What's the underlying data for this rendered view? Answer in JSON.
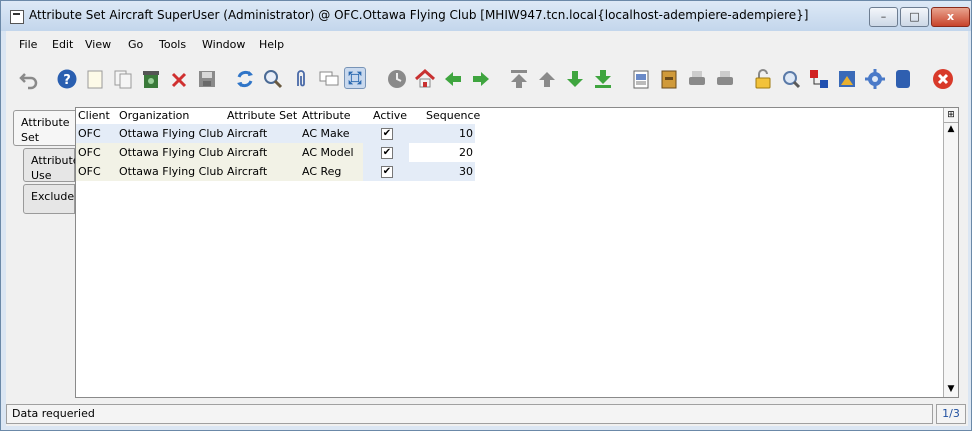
{
  "window": {
    "title": "Attribute Set  Aircraft  SuperUser (Administrator) @ OFC.Ottawa Flying Club [MHIW947.tcn.local{localhost-adempiere-adempiere}]",
    "min": "–",
    "max": "□",
    "close": "x"
  },
  "menu": [
    "File",
    "Edit",
    "View",
    "Go",
    "Tools",
    "Window",
    "Help"
  ],
  "menu_mnemonics": [
    "F",
    "E",
    "V",
    "G",
    "T",
    "",
    "H"
  ],
  "tabs": [
    {
      "label": "Attribute Set",
      "line1": "Attribute",
      "line2": "Set"
    },
    {
      "label": "Attribute Use",
      "line1": "Attribute",
      "line2": "Use"
    },
    {
      "label": "Exclude",
      "line1": "Exclude",
      "line2": ""
    }
  ],
  "grid": {
    "columns": [
      "Client",
      "Organization",
      "Attribute Set",
      "Attribute",
      "Active",
      "Sequence"
    ],
    "rows": [
      {
        "client": "OFC",
        "org": "Ottawa Flying Club",
        "set": "Aircraft",
        "attribute": "AC Make",
        "active": "✔",
        "sequence": "10"
      },
      {
        "client": "OFC",
        "org": "Ottawa Flying Club",
        "set": "Aircraft",
        "attribute": "AC Model",
        "active": "✔",
        "sequence": "20"
      },
      {
        "client": "OFC",
        "org": "Ottawa Flying Club",
        "set": "Aircraft",
        "attribute": "AC Reg",
        "active": "✔",
        "sequence": "30"
      }
    ]
  },
  "status": {
    "message": "Data requeried",
    "pager": "1/3"
  },
  "toolbar_icons": [
    "undo-icon",
    "help-icon",
    "new-record-icon",
    "copy-record-icon",
    "delete-icon",
    "delete-selection-icon",
    "save-icon",
    "refresh-icon",
    "find-icon",
    "attachment-icon",
    "chat-icon",
    "grid-toggle-icon",
    "history-icon",
    "home-icon",
    "previous-tab-icon",
    "next-tab-icon",
    "first-record-icon",
    "previous-record-icon",
    "next-record-icon",
    "last-record-icon",
    "report-icon",
    "archive-icon",
    "print-preview-icon",
    "print-icon",
    "lock-icon",
    "zoom-across-icon",
    "request-icon",
    "product-info-icon",
    "workflow-icon",
    "exit-icon"
  ]
}
